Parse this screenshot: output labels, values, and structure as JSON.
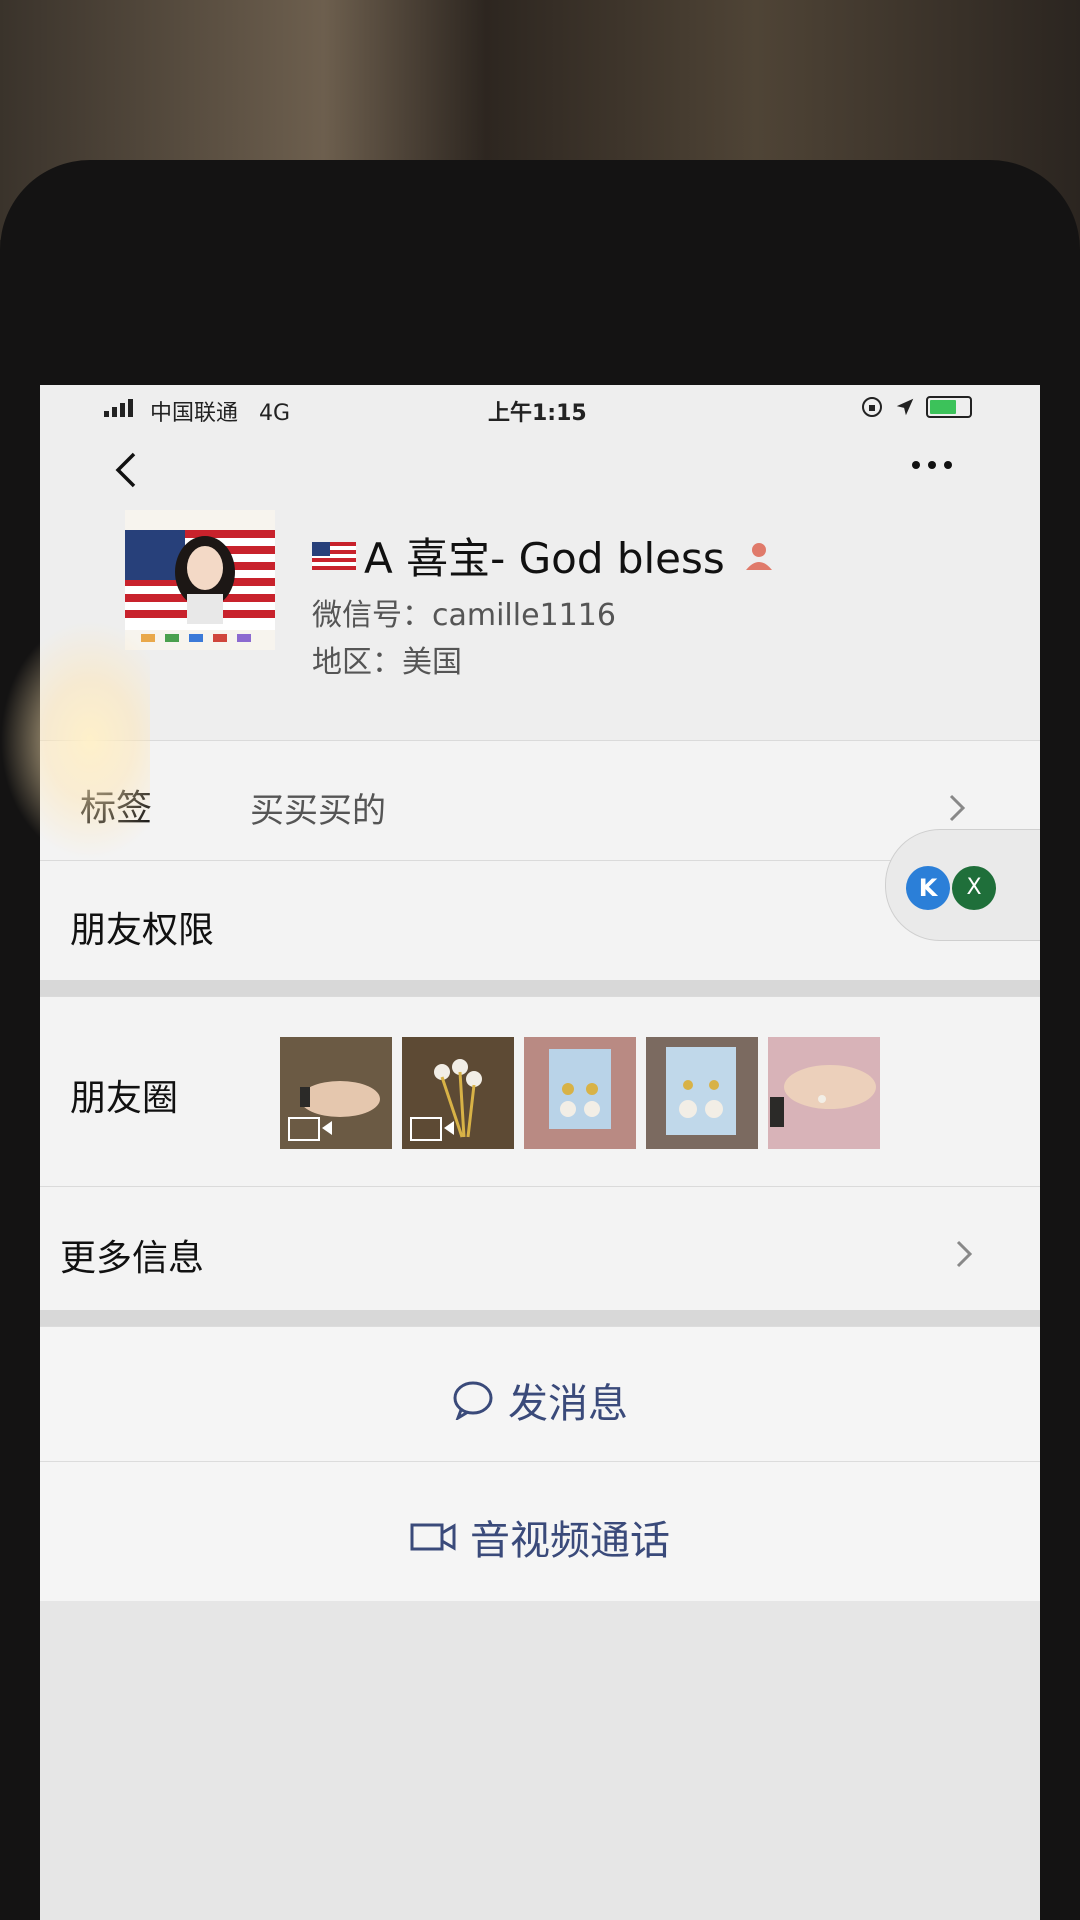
{
  "status_bar": {
    "carrier": "中国联通",
    "network": "4G",
    "time": "上午1:15"
  },
  "profile": {
    "display_name": "A 喜宝- God bless",
    "wechat_id": "微信号：camille1116",
    "region": "地区：美国"
  },
  "rows": {
    "tags_label": "标签",
    "tags_value": "买买买的",
    "permissions_label": "朋友权限",
    "moments_label": "朋友圈",
    "more_info_label": "更多信息"
  },
  "actions": {
    "message": "发消息",
    "call": "音视频通话"
  },
  "floating_apps": {
    "app1": "K",
    "app2": "X"
  },
  "colors": {
    "accent_text": "#3a4a7a",
    "battery": "#3cc25a"
  }
}
